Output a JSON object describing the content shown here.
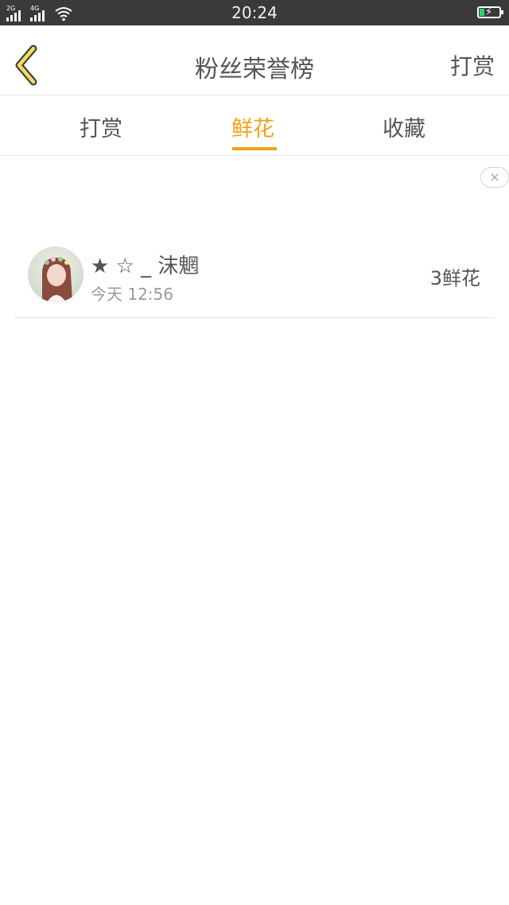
{
  "status_bar": {
    "network_1": "2G",
    "network_2": "4G",
    "time": "20:24"
  },
  "header": {
    "title": "粉丝荣誉榜",
    "action_label": "打赏",
    "back_icon": "chevron-left-icon",
    "accent_color": "#f0a21a"
  },
  "tabs": [
    {
      "label": "打赏",
      "active": false
    },
    {
      "label": "鲜花",
      "active": true
    },
    {
      "label": "收藏",
      "active": false
    }
  ],
  "ad": {
    "close_glyph": "×"
  },
  "fans": [
    {
      "name": "★ ☆ _ 沫魍",
      "time": "今天 12:56",
      "amount": "3鲜花"
    }
  ]
}
